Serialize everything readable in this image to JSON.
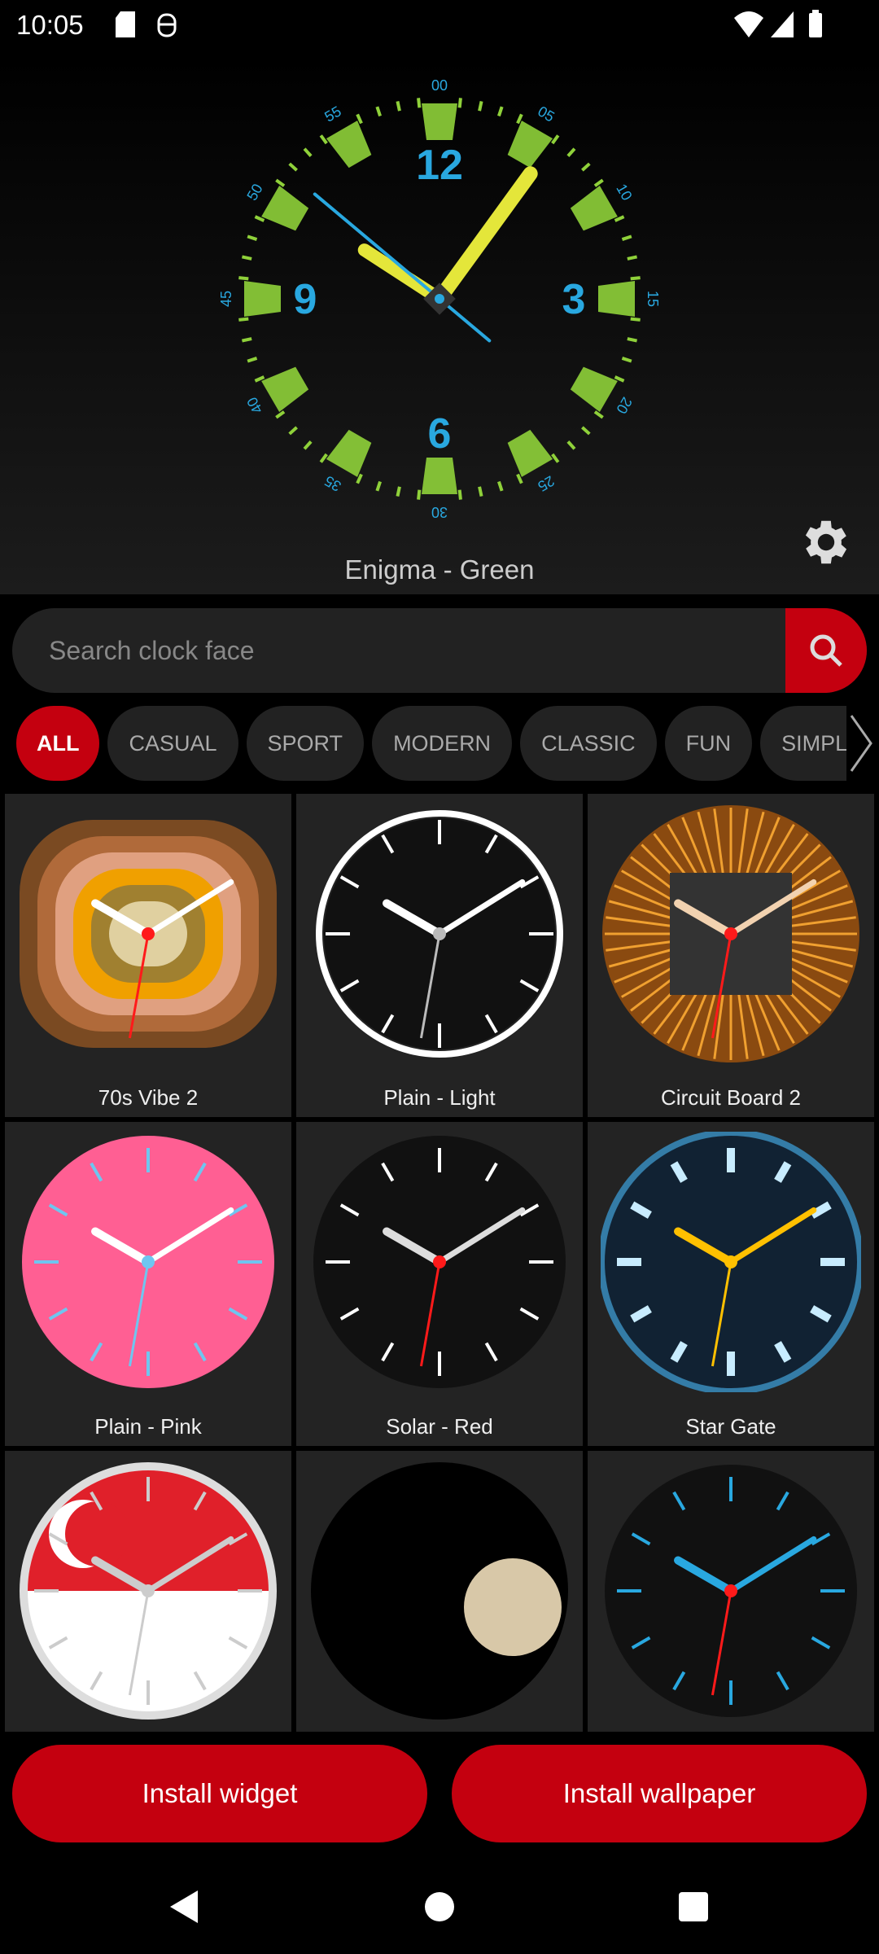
{
  "status_bar": {
    "time": "10:05",
    "icons": [
      "sd-card-icon",
      "android-debug-icon",
      "wifi-icon",
      "signal-icon",
      "battery-icon"
    ]
  },
  "preview": {
    "title": "Enigma - Green",
    "numerals": [
      "12",
      "3",
      "6",
      "9"
    ],
    "minute_labels": [
      "00",
      "05",
      "10",
      "15",
      "20",
      "25",
      "30",
      "35",
      "40",
      "45",
      "50",
      "55"
    ],
    "accent": "#29a8e0",
    "marker_color": "#8fd13a"
  },
  "search": {
    "placeholder": "Search clock face",
    "value": ""
  },
  "categories": [
    {
      "label": "ALL",
      "active": true
    },
    {
      "label": "CASUAL"
    },
    {
      "label": "SPORT"
    },
    {
      "label": "MODERN"
    },
    {
      "label": "CLASSIC"
    },
    {
      "label": "FUN"
    },
    {
      "label": "SIMPLE"
    }
  ],
  "faces": [
    {
      "name": "70s Vibe 2",
      "bg": "#7a4a22",
      "face": "#e09a30",
      "hands": "#ffffff",
      "second": "#ff1a1a"
    },
    {
      "name": "Plain - Light",
      "bg": "#111111",
      "face": "#111111",
      "ring": "#ffffff",
      "hands": "#ffffff",
      "second": "#bbbbbb"
    },
    {
      "name": "Circuit Board 2",
      "bg": "#8a4a10",
      "face": "#333333",
      "hands": "#f2d2b0",
      "second": "#ff1a1a"
    },
    {
      "name": "Plain - Pink",
      "bg": "#ff5f93",
      "face": "#ff5f93",
      "hands": "#ffffff",
      "second": "#6ec6f0",
      "ticks": "#6ec6f0"
    },
    {
      "name": "Solar - Red",
      "bg": "#111111",
      "face": "#111111",
      "hands": "#dddddd",
      "second": "#ff1a1a",
      "ticks": "#ffffff"
    },
    {
      "name": "Star Gate",
      "bg": "#0a2a40",
      "face": "#123",
      "ring": "#3fb8ff",
      "hands": "#ffc000",
      "second": "#ffc000",
      "ticks": "#c8ecff"
    },
    {
      "name": "",
      "bg": "#ffffff",
      "face": "#ffffff",
      "hands": "#cccccc",
      "second": "#cccccc",
      "flag": true
    },
    {
      "name": "",
      "bg": "#000000",
      "face": "#000000",
      "hands": "#000000",
      "second": "#000000"
    },
    {
      "name": "",
      "bg": "#111111",
      "face": "#111111",
      "hands": "#29a8e0",
      "second": "#ff1a1a",
      "ticks": "#29a8e0"
    }
  ],
  "actions": {
    "install_widget": "Install widget",
    "install_wallpaper": "Install wallpaper"
  },
  "nav_bar": {
    "icons": [
      "back-icon",
      "home-icon",
      "recents-icon"
    ]
  }
}
